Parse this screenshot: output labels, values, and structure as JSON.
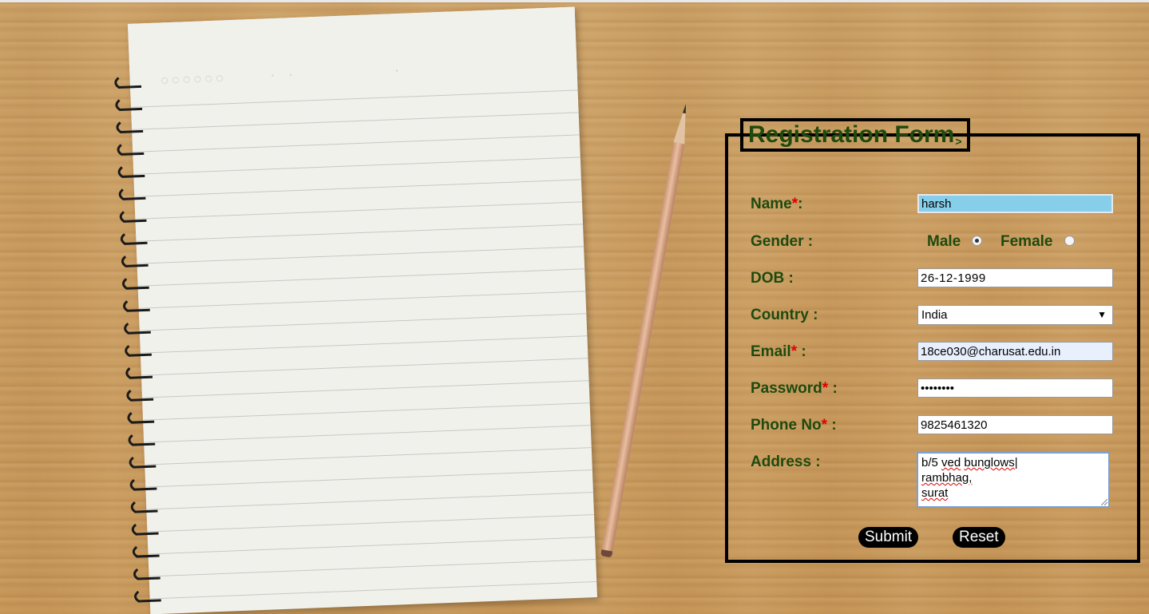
{
  "form": {
    "legend": "Registration Form",
    "legend_arrow": ">",
    "fields": {
      "name": {
        "label": "Name",
        "required_mark": "*",
        "suffix": ":",
        "value": "harsh"
      },
      "gender": {
        "label": "Gender :",
        "options": [
          "Male",
          "Female"
        ],
        "selected": "Male"
      },
      "dob": {
        "label": "DOB :",
        "value": "26-12-1999"
      },
      "country": {
        "label": "Country :",
        "selected": "India"
      },
      "email": {
        "label": "Email",
        "required_mark": "*",
        "suffix": " :",
        "value": "18ce030@charusat.edu.in"
      },
      "password": {
        "label": "Password",
        "required_mark": "*",
        "suffix": " :",
        "value": "••••••••"
      },
      "phone": {
        "label": "Phone No",
        "required_mark": "*",
        "suffix": " :",
        "value": "9825461320"
      },
      "address": {
        "label": "Address :",
        "lines": [
          "b/5 ved bunglows",
          "rambhag,",
          "surat"
        ]
      }
    },
    "buttons": {
      "submit": "Submit",
      "reset": "Reset"
    }
  },
  "colors": {
    "label": "#1e4a0e",
    "required": "#e00000",
    "focused_input": "#87ceeb",
    "button_bg": "#000000",
    "button_text": "#ffffff"
  }
}
